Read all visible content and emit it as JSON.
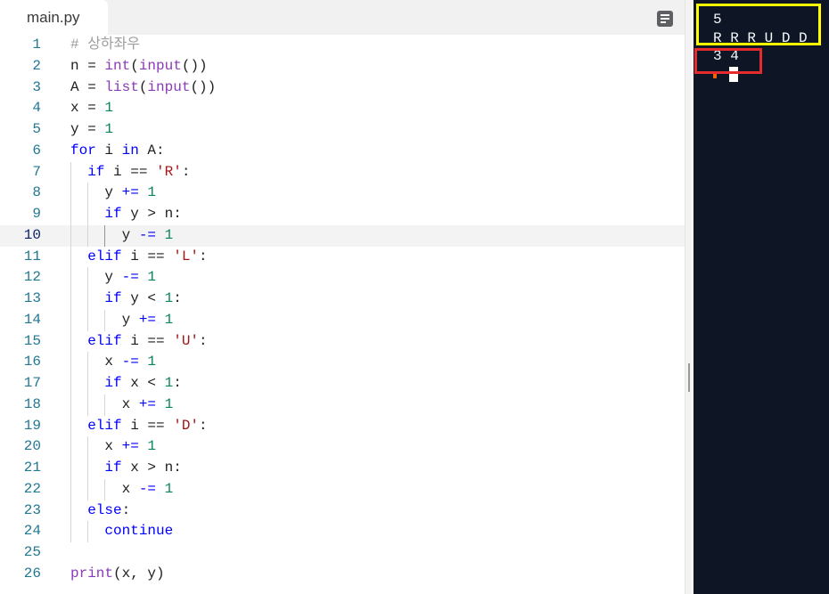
{
  "editor": {
    "tab_label": "main.py",
    "menu_icon": "outline-icon",
    "active_line": 10,
    "lines": [
      {
        "num": "1",
        "tokens": [
          {
            "comment": "# 상하좌우"
          }
        ]
      },
      {
        "num": "2",
        "tokens": [
          {
            "plain": "n = "
          },
          {
            "builtin": "int"
          },
          {
            "plain": "("
          },
          {
            "builtin": "input"
          },
          {
            "plain": "())"
          }
        ]
      },
      {
        "num": "3",
        "tokens": [
          {
            "plain": "A = "
          },
          {
            "builtin": "list"
          },
          {
            "plain": "("
          },
          {
            "builtin": "input"
          },
          {
            "plain": "())"
          }
        ]
      },
      {
        "num": "4",
        "tokens": [
          {
            "plain": "x = "
          },
          {
            "number": "1"
          }
        ]
      },
      {
        "num": "5",
        "tokens": [
          {
            "plain": "y = "
          },
          {
            "number": "1"
          }
        ]
      },
      {
        "num": "6",
        "tokens": [
          {
            "keyword": "for"
          },
          {
            "plain": " i "
          },
          {
            "keyword": "in"
          },
          {
            "plain": " A:"
          }
        ]
      },
      {
        "num": "7",
        "tokens": [
          {
            "plain": "  "
          },
          {
            "keyword": "if"
          },
          {
            "plain": " i == "
          },
          {
            "string": "'R'"
          },
          {
            "plain": ":"
          }
        ]
      },
      {
        "num": "8",
        "tokens": [
          {
            "plain": "    y "
          },
          {
            "operator": "+="
          },
          {
            "plain": " "
          },
          {
            "number": "1"
          }
        ]
      },
      {
        "num": "9",
        "tokens": [
          {
            "plain": "    "
          },
          {
            "keyword": "if"
          },
          {
            "plain": " y > n:"
          }
        ]
      },
      {
        "num": "10",
        "tokens": [
          {
            "plain": "      y "
          },
          {
            "operator": "-="
          },
          {
            "plain": " "
          },
          {
            "number": "1"
          }
        ]
      },
      {
        "num": "11",
        "tokens": [
          {
            "plain": "  "
          },
          {
            "keyword": "elif"
          },
          {
            "plain": " i == "
          },
          {
            "string": "'L'"
          },
          {
            "plain": ":"
          }
        ]
      },
      {
        "num": "12",
        "tokens": [
          {
            "plain": "    y "
          },
          {
            "operator": "-="
          },
          {
            "plain": " "
          },
          {
            "number": "1"
          }
        ]
      },
      {
        "num": "13",
        "tokens": [
          {
            "plain": "    "
          },
          {
            "keyword": "if"
          },
          {
            "plain": " y < "
          },
          {
            "number": "1"
          },
          {
            "plain": ":"
          }
        ]
      },
      {
        "num": "14",
        "tokens": [
          {
            "plain": "      y "
          },
          {
            "operator": "+="
          },
          {
            "plain": " "
          },
          {
            "number": "1"
          }
        ]
      },
      {
        "num": "15",
        "tokens": [
          {
            "plain": "  "
          },
          {
            "keyword": "elif"
          },
          {
            "plain": " i == "
          },
          {
            "string": "'U'"
          },
          {
            "plain": ":"
          }
        ]
      },
      {
        "num": "16",
        "tokens": [
          {
            "plain": "    x "
          },
          {
            "operator": "-="
          },
          {
            "plain": " "
          },
          {
            "number": "1"
          }
        ]
      },
      {
        "num": "17",
        "tokens": [
          {
            "plain": "    "
          },
          {
            "keyword": "if"
          },
          {
            "plain": " x < "
          },
          {
            "number": "1"
          },
          {
            "plain": ":"
          }
        ]
      },
      {
        "num": "18",
        "tokens": [
          {
            "plain": "      x "
          },
          {
            "operator": "+="
          },
          {
            "plain": " "
          },
          {
            "number": "1"
          }
        ]
      },
      {
        "num": "19",
        "tokens": [
          {
            "plain": "  "
          },
          {
            "keyword": "elif"
          },
          {
            "plain": " i == "
          },
          {
            "string": "'D'"
          },
          {
            "plain": ":"
          }
        ]
      },
      {
        "num": "20",
        "tokens": [
          {
            "plain": "    x "
          },
          {
            "operator": "+="
          },
          {
            "plain": " "
          },
          {
            "number": "1"
          }
        ]
      },
      {
        "num": "21",
        "tokens": [
          {
            "plain": "    "
          },
          {
            "keyword": "if"
          },
          {
            "plain": " x > n:"
          }
        ]
      },
      {
        "num": "22",
        "tokens": [
          {
            "plain": "      x "
          },
          {
            "operator": "-="
          },
          {
            "plain": " "
          },
          {
            "number": "1"
          }
        ]
      },
      {
        "num": "23",
        "tokens": [
          {
            "plain": "  "
          },
          {
            "keyword": "else"
          },
          {
            "plain": ":"
          }
        ]
      },
      {
        "num": "24",
        "tokens": [
          {
            "plain": "    "
          },
          {
            "keyword": "continue"
          }
        ]
      },
      {
        "num": "25",
        "tokens": []
      },
      {
        "num": "26",
        "tokens": [
          {
            "builtin": "print"
          },
          {
            "plain": "(x, y)"
          }
        ]
      }
    ]
  },
  "console": {
    "output": [
      "5",
      "R R R U D D",
      "3 4"
    ],
    "prompt_icon": "prompt-icon",
    "cursor_icon": "text-cursor-icon"
  },
  "theme": {
    "syntax": {
      "plain": "#1f1f1f",
      "keyword": "#0000ff",
      "builtin": "#8a3ab9",
      "number": "#098658",
      "string": "#a31515",
      "operator": "#0000ff",
      "comment": "#9e9e9e"
    },
    "line_number": "#237893",
    "line_number_active": "#0b216f",
    "console_background": "#0e1525",
    "console_text": "#f5f9fc",
    "prompt": "#f26207",
    "annotation_yellow": "#ffff00",
    "annotation_red": "#e52b2b"
  }
}
